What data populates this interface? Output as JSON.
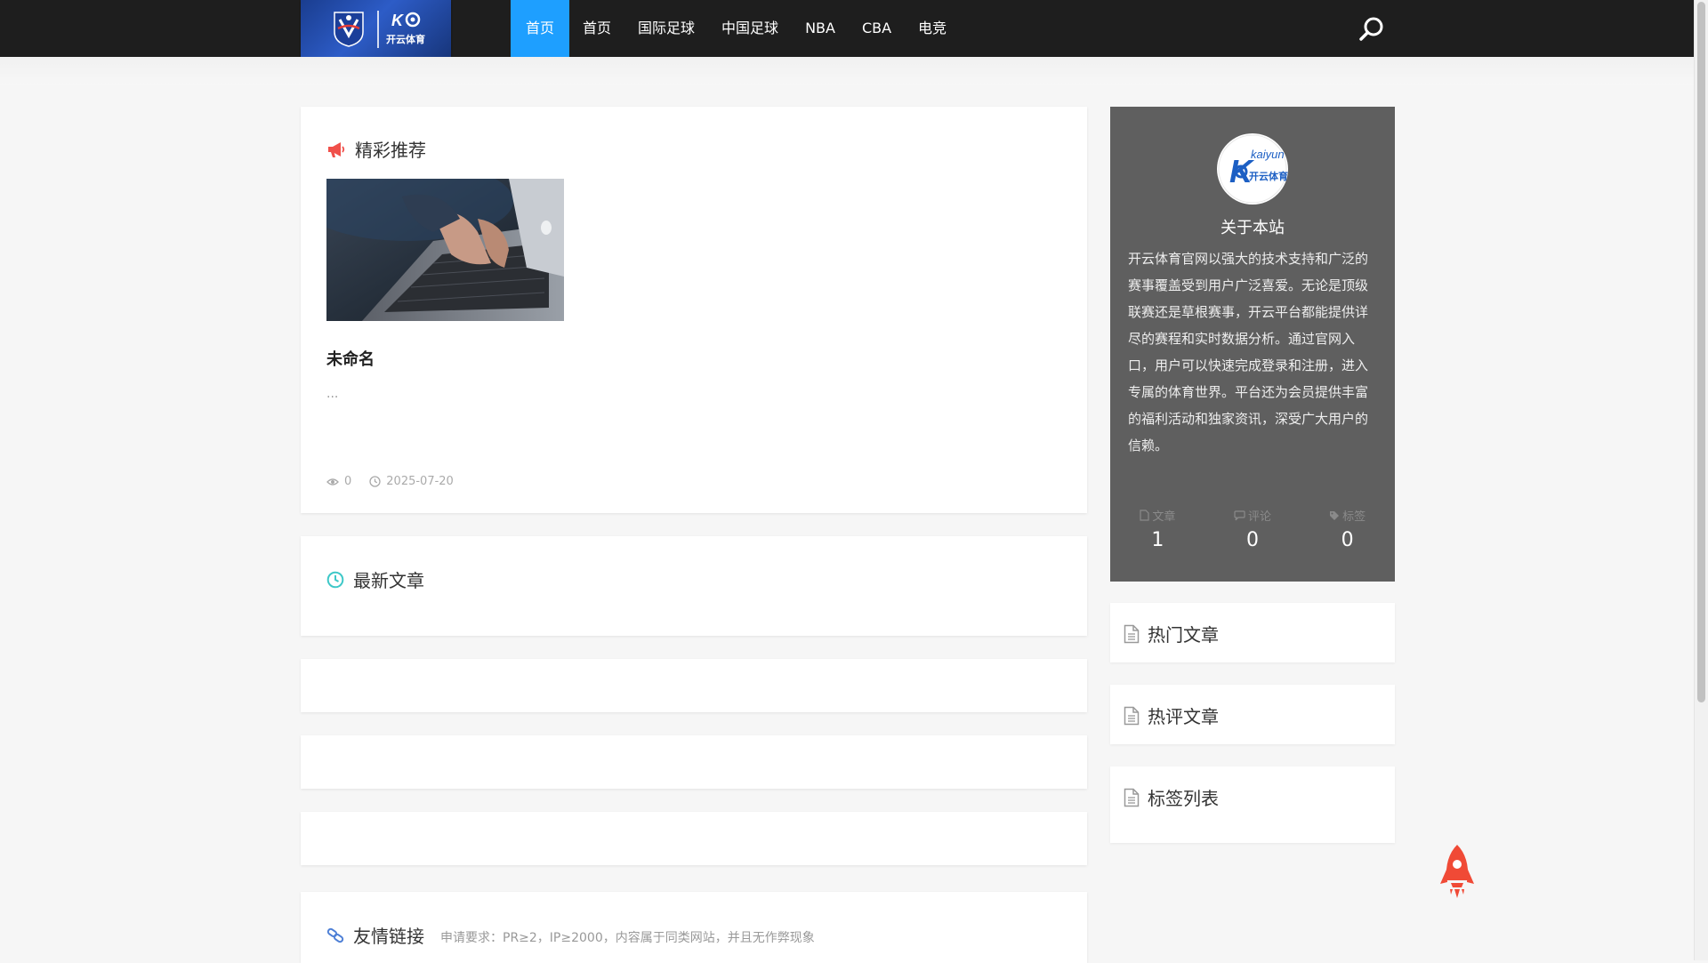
{
  "logo": {
    "text": "开云体育"
  },
  "nav": {
    "items": [
      {
        "label": "首页",
        "active": true
      },
      {
        "label": "首页",
        "active": false
      },
      {
        "label": "国际足球",
        "active": false
      },
      {
        "label": "中国足球",
        "active": false
      },
      {
        "label": "NBA",
        "active": false
      },
      {
        "label": "CBA",
        "active": false
      },
      {
        "label": "电竞",
        "active": false
      }
    ],
    "search_icon": "search-icon"
  },
  "featured": {
    "title": "精彩推荐",
    "post": {
      "title": "未命名",
      "excerpt": "...",
      "views": "0",
      "date": "2025-07-20"
    }
  },
  "latest": {
    "title": "最新文章"
  },
  "friends": {
    "title": "友情链接",
    "requirement": "申请要求：PR≥2，IP≥2000，内容属于同类网站，并且无作弊现象"
  },
  "about": {
    "avatar_text": "kaiyun",
    "avatar_subtext": "开云体育",
    "title": "关于本站",
    "description": "开云体育官网以强大的技术支持和广泛的赛事覆盖受到用户广泛喜爱。无论是顶级联赛还是草根赛事，开云平台都能提供详尽的赛程和实时数据分析。通过官网入口，用户可以快速完成登录和注册，进入专属的体育世界。平台还为会员提供丰富的福利活动和独家资讯，深受广大用户的信赖。",
    "stats": [
      {
        "label": "文章",
        "value": "1"
      },
      {
        "label": "评论",
        "value": "0"
      },
      {
        "label": "标签",
        "value": "0"
      }
    ]
  },
  "widgets": {
    "hot_posts": "热门文章",
    "hot_comments": "热评文章",
    "tag_list": "标签列表"
  },
  "colors": {
    "nav_bg": "#1e1e1e",
    "nav_active": "#1e9fff",
    "about_bg": "#5f5f5f",
    "page_bg": "#f6f6f6",
    "featured_icon": "#f0504a",
    "latest_icon": "#3ec8c8",
    "friends_icon": "#4d7fd6",
    "rocket": "#f04a36"
  }
}
